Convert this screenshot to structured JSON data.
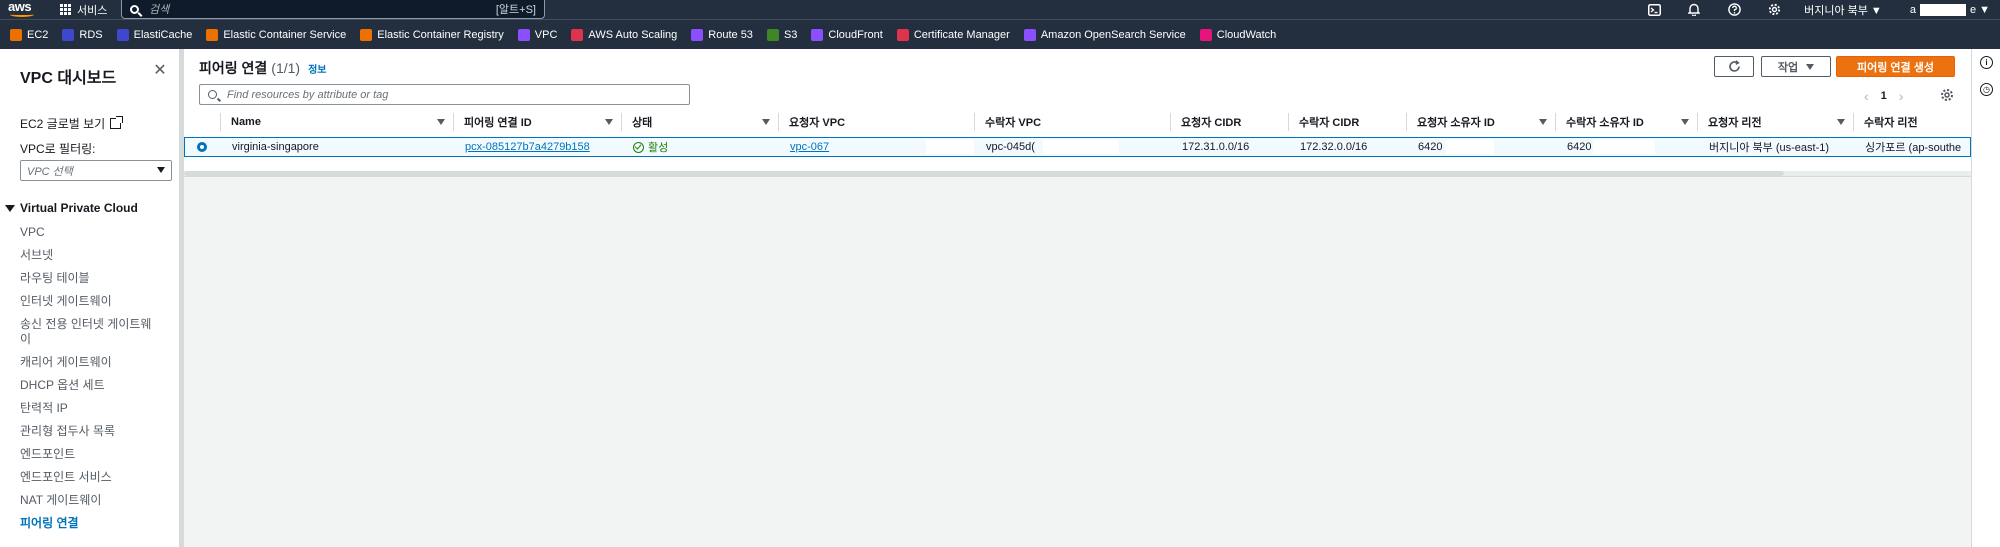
{
  "topnav": {
    "logo": "aws",
    "services_label": "서비스",
    "search_placeholder": "검색",
    "search_shortcut": "[알트+S]",
    "region": "버지니아 북부 ▼",
    "account": "a",
    "account_suffix": "e ▼"
  },
  "favorites": [
    {
      "label": "EC2",
      "color": "#ed7100"
    },
    {
      "label": "RDS",
      "color": "#3f48cc"
    },
    {
      "label": "ElastiCache",
      "color": "#3f48cc"
    },
    {
      "label": "Elastic Container Service",
      "color": "#ed7100"
    },
    {
      "label": "Elastic Container Registry",
      "color": "#ed7100"
    },
    {
      "label": "VPC",
      "color": "#8c4fff"
    },
    {
      "label": "AWS Auto Scaling",
      "color": "#dd344c"
    },
    {
      "label": "Route 53",
      "color": "#8c4fff"
    },
    {
      "label": "S3",
      "color": "#3f8624"
    },
    {
      "label": "CloudFront",
      "color": "#8c4fff"
    },
    {
      "label": "Certificate Manager",
      "color": "#dd344c"
    },
    {
      "label": "Amazon OpenSearch Service",
      "color": "#8c4fff"
    },
    {
      "label": "CloudWatch",
      "color": "#e7157b"
    }
  ],
  "sidebar": {
    "title": "VPC 대시보드",
    "ec2_global": "EC2 글로벌 보기",
    "filter_label": "VPC로 필터링:",
    "filter_placeholder": "VPC 선택",
    "section": "Virtual Private Cloud",
    "items": [
      {
        "label": "VPC"
      },
      {
        "label": "서브넷"
      },
      {
        "label": "라우팅 테이블"
      },
      {
        "label": "인터넷 게이트웨이"
      },
      {
        "label": "송신 전용 인터넷 게이트웨이"
      },
      {
        "label": "캐리어 게이트웨이"
      },
      {
        "label": "DHCP 옵션 세트"
      },
      {
        "label": "탄력적 IP"
      },
      {
        "label": "관리형 접두사 목록"
      },
      {
        "label": "엔드포인트"
      },
      {
        "label": "엔드포인트 서비스"
      },
      {
        "label": "NAT 게이트웨이"
      },
      {
        "label": "피어링 연결"
      }
    ]
  },
  "main": {
    "title": "피어링 연결",
    "count": "(1/1)",
    "info": "정보",
    "actions_label": "작업",
    "create_label": "피어링 연결 생성",
    "search_placeholder": "Find resources by attribute or tag",
    "page": "1",
    "columns": [
      "Name",
      "피어링 연결 ID",
      "상태",
      "요청자 VPC",
      "수락자 VPC",
      "요청자 CIDR",
      "수락자 CIDR",
      "요청자 소유자 ID",
      "수락자 소유자 ID",
      "요청자 리전",
      "수락자 리전"
    ],
    "row": {
      "name": "virginia-singapore",
      "peering_id": "pcx-085127b7a4279b158",
      "status": "활성",
      "requester_vpc": "vpc-067",
      "accepter_vpc": "vpc-045d(",
      "requester_cidr": "172.31.0.0/16",
      "accepter_cidr": "172.32.0.0/16",
      "requester_owner": "6420",
      "accepter_owner": "6420",
      "requester_region": "버지니아 북부 (us-east-1)",
      "accepter_region": "싱가포르 (ap-southe"
    }
  }
}
